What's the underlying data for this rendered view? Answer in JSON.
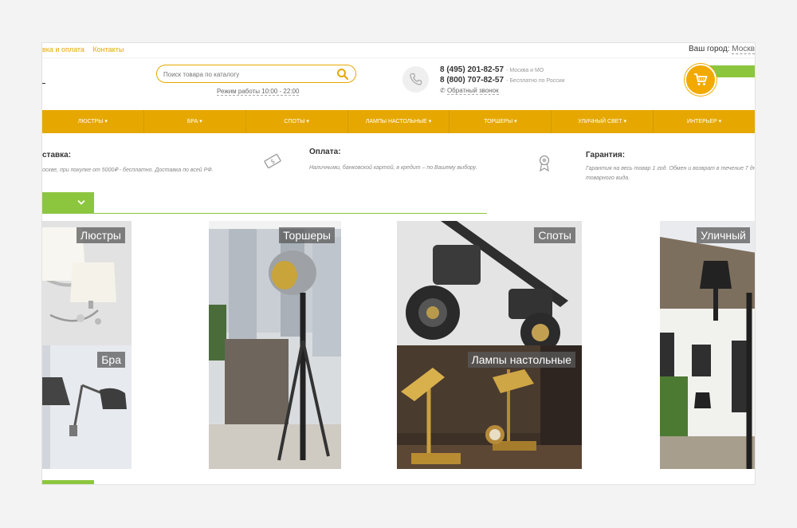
{
  "top_links": [
    "вка и оплата",
    "Контакты"
  ],
  "city": {
    "label": "Ваш город:",
    "value": "Москв"
  },
  "search": {
    "placeholder": "Поиск товара по каталогу"
  },
  "work_hours": "Режим работы 10:00 - 22:00",
  "phones": [
    {
      "number": "8 (495) 201-82-57",
      "note": "- Москва и МО"
    },
    {
      "number": "8 (800) 707-82-57",
      "note": "- Бесплатно по России"
    }
  ],
  "callback": "Обратный звонок",
  "nav": [
    "Люстры",
    "Бра",
    "Споты",
    "Лампы настольные",
    "Торшеры",
    "Уличный свет",
    "Интерьер"
  ],
  "info": {
    "delivery": {
      "title": "ставка:",
      "text": "оскве, при покупке от 5000₽ - бесплатно. Доставка по всей РФ."
    },
    "payment": {
      "title": "Оплата:",
      "text": "Наличными, банковской картой, в кредит – по Вашему выбору."
    },
    "warranty": {
      "title": "Гарантия:",
      "text_1": "Гарантия на весь товар 1 год. Обмен и возврат в течение 7 дне",
      "text_2": "товарного вида."
    }
  },
  "tiles": {
    "chandeliers": "Люстры",
    "floor_lamps": "Торшеры",
    "spots": "Споты",
    "outdoor": "Уличный",
    "sconces": "Бра",
    "table_lamps": "Лампы настольные"
  },
  "colors": {
    "accent": "#e6a800",
    "green": "#8cc63f"
  }
}
